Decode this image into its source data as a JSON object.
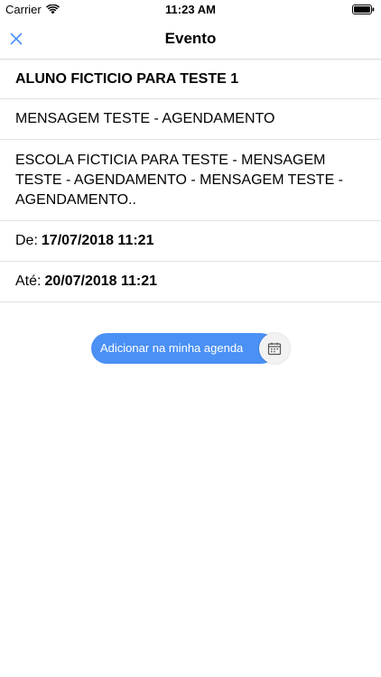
{
  "status_bar": {
    "carrier": "Carrier",
    "time": "11:23 AM",
    "icons": [
      "wifi-icon",
      "battery-icon"
    ]
  },
  "nav": {
    "title": "Evento",
    "close_icon": "close-icon"
  },
  "event": {
    "student": "ALUNO FICTICIO PARA TESTE 1",
    "subject": "MENSAGEM TESTE - AGENDAMENTO",
    "description": "ESCOLA FICTICIA PARA TESTE - MENSAGEM TESTE - AGENDAMENTO - MENSAGEM TESTE - AGENDAMENTO..",
    "start_label": "De:",
    "start_value": "17/07/2018 11:21",
    "end_label": "Até:",
    "end_value": "20/07/2018 11:21"
  },
  "actions": {
    "add_to_calendar_label": "Adicionar na minha agenda",
    "add_to_calendar_icon": "calendar-icon"
  },
  "colors": {
    "accent": "#4a90f5",
    "close_icon": "#4a90f5",
    "separator": "#e2e2e2"
  }
}
